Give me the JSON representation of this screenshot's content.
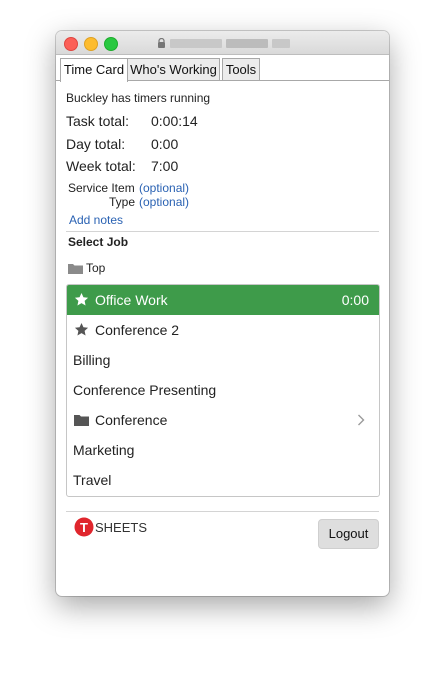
{
  "tabs": [
    "Time Card",
    "Who's Working",
    "Tools"
  ],
  "status": "Buckley has timers running",
  "totals": [
    {
      "label": "Task total:",
      "value": "0:00:14"
    },
    {
      "label": "Day total:",
      "value": "0:00"
    },
    {
      "label": "Week total:",
      "value": "7:00"
    }
  ],
  "service_item": {
    "label": "Service Item",
    "link": "(optional)"
  },
  "type": {
    "label": "Type",
    "link": "(optional)"
  },
  "add_notes": "Add notes",
  "select_job": "Select Job",
  "breadcrumb": "Top",
  "jobs": [
    {
      "label": "Office Work",
      "time": "0:00",
      "icon": "star-icon",
      "selected": true
    },
    {
      "label": "Conference 2",
      "icon": "star-icon"
    },
    {
      "label": "Billing"
    },
    {
      "label": "Conference Presenting"
    },
    {
      "label": "Conference",
      "icon": "folder-icon",
      "chevron": true
    },
    {
      "label": "Marketing"
    },
    {
      "label": "Travel"
    }
  ],
  "logo": {
    "letter": "T",
    "text": "SHEETS",
    "color": "#e0262d"
  },
  "logout": "Logout",
  "colors": {
    "selected_row": "#3e9b4a",
    "link": "#2a62b3"
  }
}
